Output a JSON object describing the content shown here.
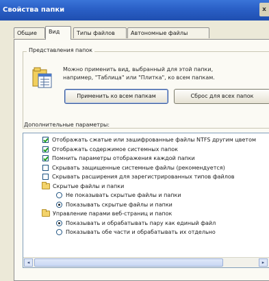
{
  "window": {
    "title": "Свойства папки",
    "close_glyph": "x"
  },
  "tabs": [
    {
      "label": "Общие",
      "active": false
    },
    {
      "label": "Вид",
      "active": true
    },
    {
      "label": "Типы файлов",
      "active": false
    },
    {
      "label": "Автономные файлы",
      "active": false
    }
  ],
  "folder_views": {
    "group_label": "Представления папок",
    "description_line1": "Можно применить вид, выбранный для этой папки,",
    "description_line2": "например, \"Таблица\" или \"Плитка\", ко всем папкам.",
    "apply_button": "Применить ко всем папкам",
    "reset_button": "Сброс для всех папок"
  },
  "advanced": {
    "label": "Дополнительные параметры:",
    "items": [
      {
        "kind": "checkbox",
        "checked": true,
        "label": "Отображать сжатые или зашифрованные файлы NTFS другим цветом"
      },
      {
        "kind": "checkbox",
        "checked": true,
        "label": "Отображать содержимое системных папок"
      },
      {
        "kind": "checkbox",
        "checked": true,
        "label": "Помнить параметры отображения каждой папки"
      },
      {
        "kind": "checkbox",
        "checked": false,
        "label": "Скрывать защищенные системные файлы (рекомендуется)"
      },
      {
        "kind": "checkbox",
        "checked": false,
        "label": "Скрывать расширения для зарегистрированных типов файлов"
      },
      {
        "kind": "folder",
        "label": "Скрытые файлы и папки"
      },
      {
        "kind": "radio",
        "checked": false,
        "label": "Не показывать скрытые файлы и папки"
      },
      {
        "kind": "radio",
        "checked": true,
        "label": "Показывать скрытые файлы и папки"
      },
      {
        "kind": "folder",
        "label": "Управление парами веб-страниц и папок"
      },
      {
        "kind": "radio",
        "checked": true,
        "label": "Показывать и обрабатывать пару как единый файл"
      },
      {
        "kind": "radio",
        "checked": false,
        "label": "Показывать обе части и обрабатывать их отдельно"
      }
    ]
  },
  "scrollbar": {
    "left_glyph": "◂",
    "right_glyph": "▸"
  },
  "colors": {
    "titlebar": "#2a5fc6",
    "check": "#21a121",
    "dialog_bg": "#ece9d8"
  },
  "icons": [
    "folder-views-icon",
    "folder-icon",
    "checkbox-icon",
    "radio-icon"
  ]
}
